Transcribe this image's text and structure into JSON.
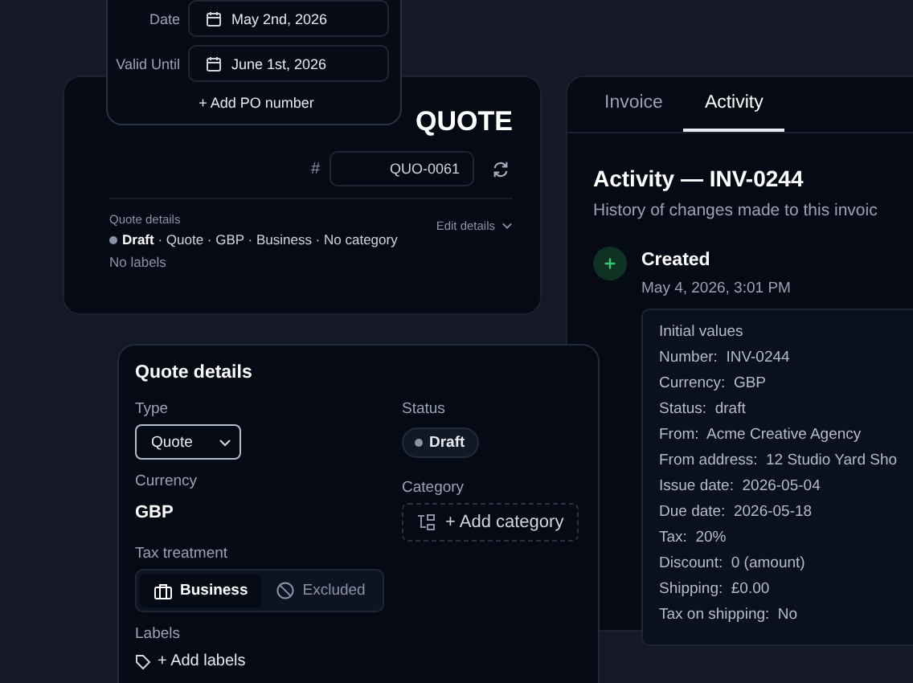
{
  "date_popover": {
    "fields": [
      {
        "label": "Date",
        "value": "May 2nd, 2026"
      },
      {
        "label": "Valid Until",
        "value": "June 1st, 2026"
      }
    ],
    "add_po": "+ Add PO number"
  },
  "quote_header": {
    "title": "QUOTE",
    "number_prefix": "#",
    "number": "QUO-0061",
    "details_label": "Quote details",
    "edit_details": "Edit details",
    "summary": "**Draft** · Quote · GBP · Business · No category",
    "labels_text": "No labels"
  },
  "activity_panel": {
    "tabs": [
      {
        "label": "Invoice",
        "selected": false
      },
      {
        "label": "Activity",
        "selected": true
      }
    ],
    "heading": "Activity — INV-0244",
    "subheading": "History of changes made to this invoic",
    "events": [
      {
        "kind": "created",
        "title": "Created",
        "time": "May 4, 2026, 3:01 PM",
        "details_title": "Initial values",
        "rows": [
          {
            "key": "Number:",
            "value": "INV-0244"
          },
          {
            "key": "Currency:",
            "value": "GBP"
          },
          {
            "key": "Status:",
            "value": "draft"
          },
          {
            "key": "From:",
            "value": "Acme Creative Agency"
          },
          {
            "key": "From address:",
            "value": "12 Studio Yard Sho"
          },
          {
            "key": "Issue date:",
            "value": "2026-05-04"
          },
          {
            "key": "Due date:",
            "value": "2026-05-18"
          },
          {
            "key": "Tax:",
            "value": "20%"
          },
          {
            "key": "Discount:",
            "value": "0 (amount)"
          },
          {
            "key": "Shipping:",
            "value": "£0.00"
          },
          {
            "key": "Tax on shipping:",
            "value": "No"
          }
        ]
      }
    ]
  },
  "quote_details": {
    "title": "Quote details",
    "type_label": "Type",
    "type_value": "Quote",
    "status_label": "Status",
    "status_value": "Draft",
    "currency_label": "Currency",
    "currency_value": "GBP",
    "category_label": "Category",
    "add_category": "+ Add category",
    "tax_label": "Tax treatment",
    "tax_options": [
      {
        "label": "Business",
        "kind": "business",
        "selected": true
      },
      {
        "label": "Excluded",
        "kind": "excluded",
        "selected": false
      }
    ],
    "labels_label": "Labels",
    "add_labels": "+ Add labels"
  }
}
